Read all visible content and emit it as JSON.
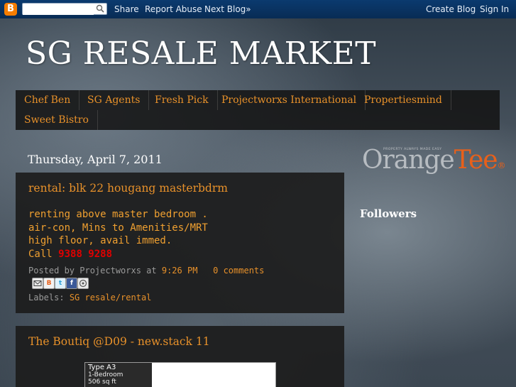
{
  "navbar": {
    "logo_letter": "B",
    "search_placeholder": "",
    "links": {
      "share": "Share",
      "report_abuse": "Report Abuse",
      "next_blog": "Next Blog»",
      "create_blog": "Create Blog",
      "sign_in": "Sign In"
    }
  },
  "header": {
    "title": "SG RESALE MARKET"
  },
  "tabs": [
    {
      "label": "Chef Ben"
    },
    {
      "label": "SG Agents"
    },
    {
      "label": "Fresh Pick"
    },
    {
      "label": "Projectworxs International"
    },
    {
      "label": "Propertiesmind"
    },
    {
      "label": "Sweet Bistro"
    }
  ],
  "date_header": "Thursday, April 7, 2011",
  "posts": [
    {
      "title": "rental: blk 22 hougang masterbdrm",
      "body_lines": [
        "renting above master bedroom .",
        "air-con, Mins to Amenities/MRT",
        "high floor, avail immed."
      ],
      "call_label": "Call ",
      "phone": "9388 9288",
      "posted_by_label": "Posted by Projectworxs at",
      "time": "9:26 PM",
      "comments": "0 comments",
      "share_icons": [
        "email-icon",
        "blogthis-icon",
        "twitter-icon",
        "facebook-icon",
        "buzz-icon"
      ],
      "labels_label": "Labels:",
      "labels": "SG resale/rental"
    },
    {
      "title": "The Boutiq @D09 - new.stack 11",
      "image": {
        "type_label": "Type A3",
        "lines": [
          "1-Bedroom",
          "506 sq ft"
        ]
      }
    }
  ],
  "sidebar": {
    "sponsor": {
      "tagline": "PROPERTY ALWAYS MADE EASY",
      "word1": "Orange",
      "word2": "Tee",
      "mark": "®"
    },
    "followers_title": "Followers"
  },
  "colors": {
    "accent": "#e8912a",
    "phone": "#e00000",
    "navbar": "#0b3a6f"
  }
}
